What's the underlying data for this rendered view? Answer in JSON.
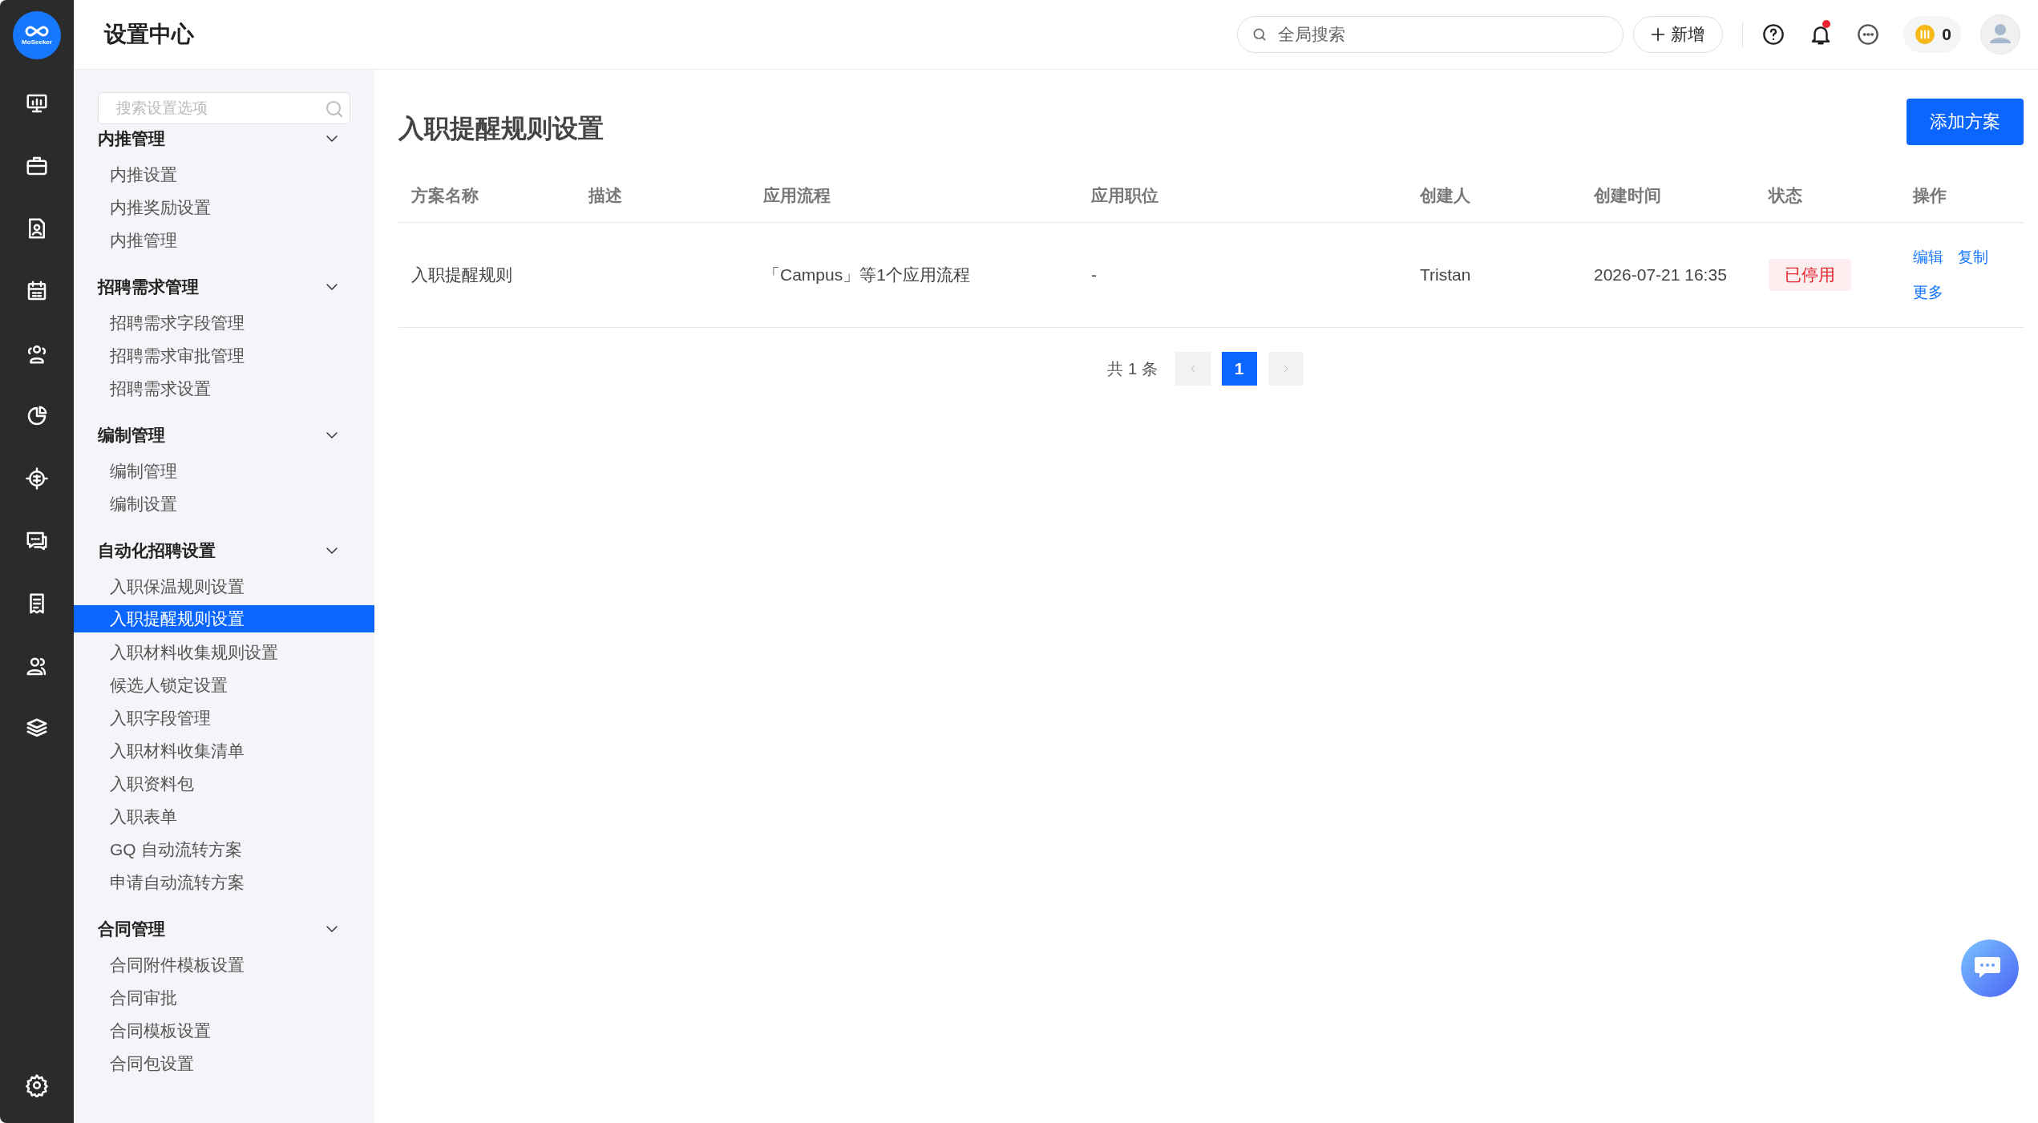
{
  "logo": {
    "text": "MoSeeker"
  },
  "header": {
    "title": "设置中心",
    "search": {
      "placeholder": "全局搜索"
    },
    "new_button": "新增",
    "has_notification": true,
    "coins": "0"
  },
  "sidebar": {
    "search": {
      "placeholder": "搜索设置选项"
    },
    "groups": [
      {
        "title": "内推管理",
        "expanded": true,
        "items": [
          {
            "label": "内推设置",
            "selected": false
          },
          {
            "label": "内推奖励设置",
            "selected": false
          },
          {
            "label": "内推管理",
            "selected": false
          }
        ]
      },
      {
        "title": "招聘需求管理",
        "expanded": true,
        "items": [
          {
            "label": "招聘需求字段管理",
            "selected": false
          },
          {
            "label": "招聘需求审批管理",
            "selected": false
          },
          {
            "label": "招聘需求设置",
            "selected": false
          }
        ]
      },
      {
        "title": "编制管理",
        "expanded": true,
        "items": [
          {
            "label": "编制管理",
            "selected": false
          },
          {
            "label": "编制设置",
            "selected": false
          }
        ]
      },
      {
        "title": "自动化招聘设置",
        "expanded": true,
        "items": [
          {
            "label": "入职保温规则设置",
            "selected": false
          },
          {
            "label": "入职提醒规则设置",
            "selected": true
          },
          {
            "label": "入职材料收集规则设置",
            "selected": false
          },
          {
            "label": "候选人锁定设置",
            "selected": false
          },
          {
            "label": "入职字段管理",
            "selected": false
          },
          {
            "label": "入职材料收集清单",
            "selected": false
          },
          {
            "label": "入职资料包",
            "selected": false
          },
          {
            "label": "入职表单",
            "selected": false
          },
          {
            "label": "GQ 自动流转方案",
            "selected": false
          },
          {
            "label": "申请自动流转方案",
            "selected": false
          }
        ]
      },
      {
        "title": "合同管理",
        "expanded": true,
        "items": [
          {
            "label": "合同附件模板设置",
            "selected": false
          },
          {
            "label": "合同审批",
            "selected": false
          },
          {
            "label": "合同模板设置",
            "selected": false
          },
          {
            "label": "合同包设置",
            "selected": false
          }
        ]
      }
    ]
  },
  "main": {
    "title": "入职提醒规则设置",
    "add_button": "添加方案",
    "table": {
      "columns": [
        "方案名称",
        "描述",
        "应用流程",
        "应用职位",
        "创建人",
        "创建时间",
        "状态",
        "操作"
      ],
      "rows": [
        {
          "name": "入职提醒规则",
          "process": "「Campus」等1个应用流程",
          "position": "-",
          "creator": "Tristan",
          "created": "2026-07-21 16:35",
          "status": {
            "label": "已停用",
            "active": false
          },
          "actions": [
            "编辑",
            "复制",
            "更多"
          ]
        }
      ]
    },
    "pagination": {
      "total": "共 1 条",
      "prev_disabled": true,
      "next_disabled": true,
      "pages": [
        {
          "label": "1",
          "selected": true
        }
      ]
    }
  }
}
